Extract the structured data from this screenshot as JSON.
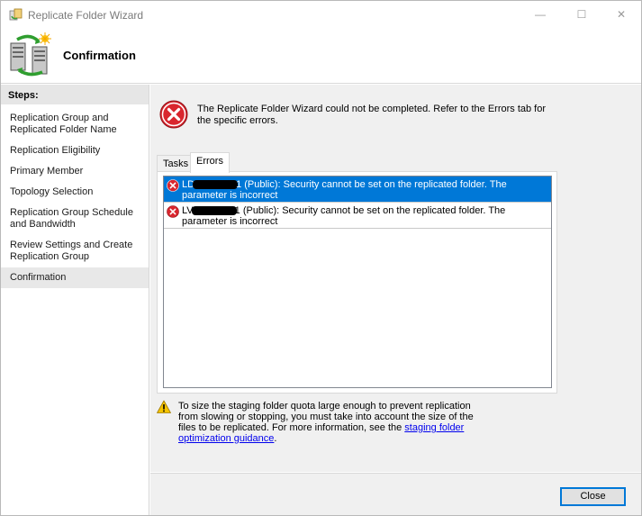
{
  "window": {
    "title": "Replicate Folder Wizard",
    "controls": {
      "minimize": "—",
      "maximize": "☐",
      "close": "✕"
    }
  },
  "header": {
    "title": "Confirmation"
  },
  "sidebar": {
    "steps_label": "Steps:",
    "items": [
      {
        "label": "Replication Group and Replicated Folder Name"
      },
      {
        "label": "Replication Eligibility"
      },
      {
        "label": "Primary Member"
      },
      {
        "label": "Topology Selection"
      },
      {
        "label": "Replication Group Schedule and Bandwidth"
      },
      {
        "label": "Review Settings and Create Replication Group"
      },
      {
        "label": "Confirmation"
      }
    ],
    "active_index": 6
  },
  "status": {
    "icon": "error-icon",
    "message": "The Replicate Folder Wizard could not be completed. Refer to the Errors tab for the specific errors."
  },
  "tabs": [
    {
      "label": "Tasks"
    },
    {
      "label": "Errors"
    }
  ],
  "errors": [
    {
      "prefix": "LD",
      "text": "1 (Public): Security cannot be set on the replicated folder. The parameter is incorrect"
    },
    {
      "prefix": "LV",
      "text": "1 (Public): Security cannot be set on the replicated folder. The parameter is incorrect"
    }
  ],
  "warning": {
    "icon": "warning-icon",
    "text": "To size the staging folder quota large enough to prevent replication from slowing or stopping, you must take into account the size of the files to be replicated. For more information, see the ",
    "link": "staging folder optimization guidance",
    "suffix": "."
  },
  "footer": {
    "close_label": "Close"
  },
  "colors": {
    "selection": "#0078d7",
    "error": "#d9262e",
    "warning": "#f5c400"
  }
}
